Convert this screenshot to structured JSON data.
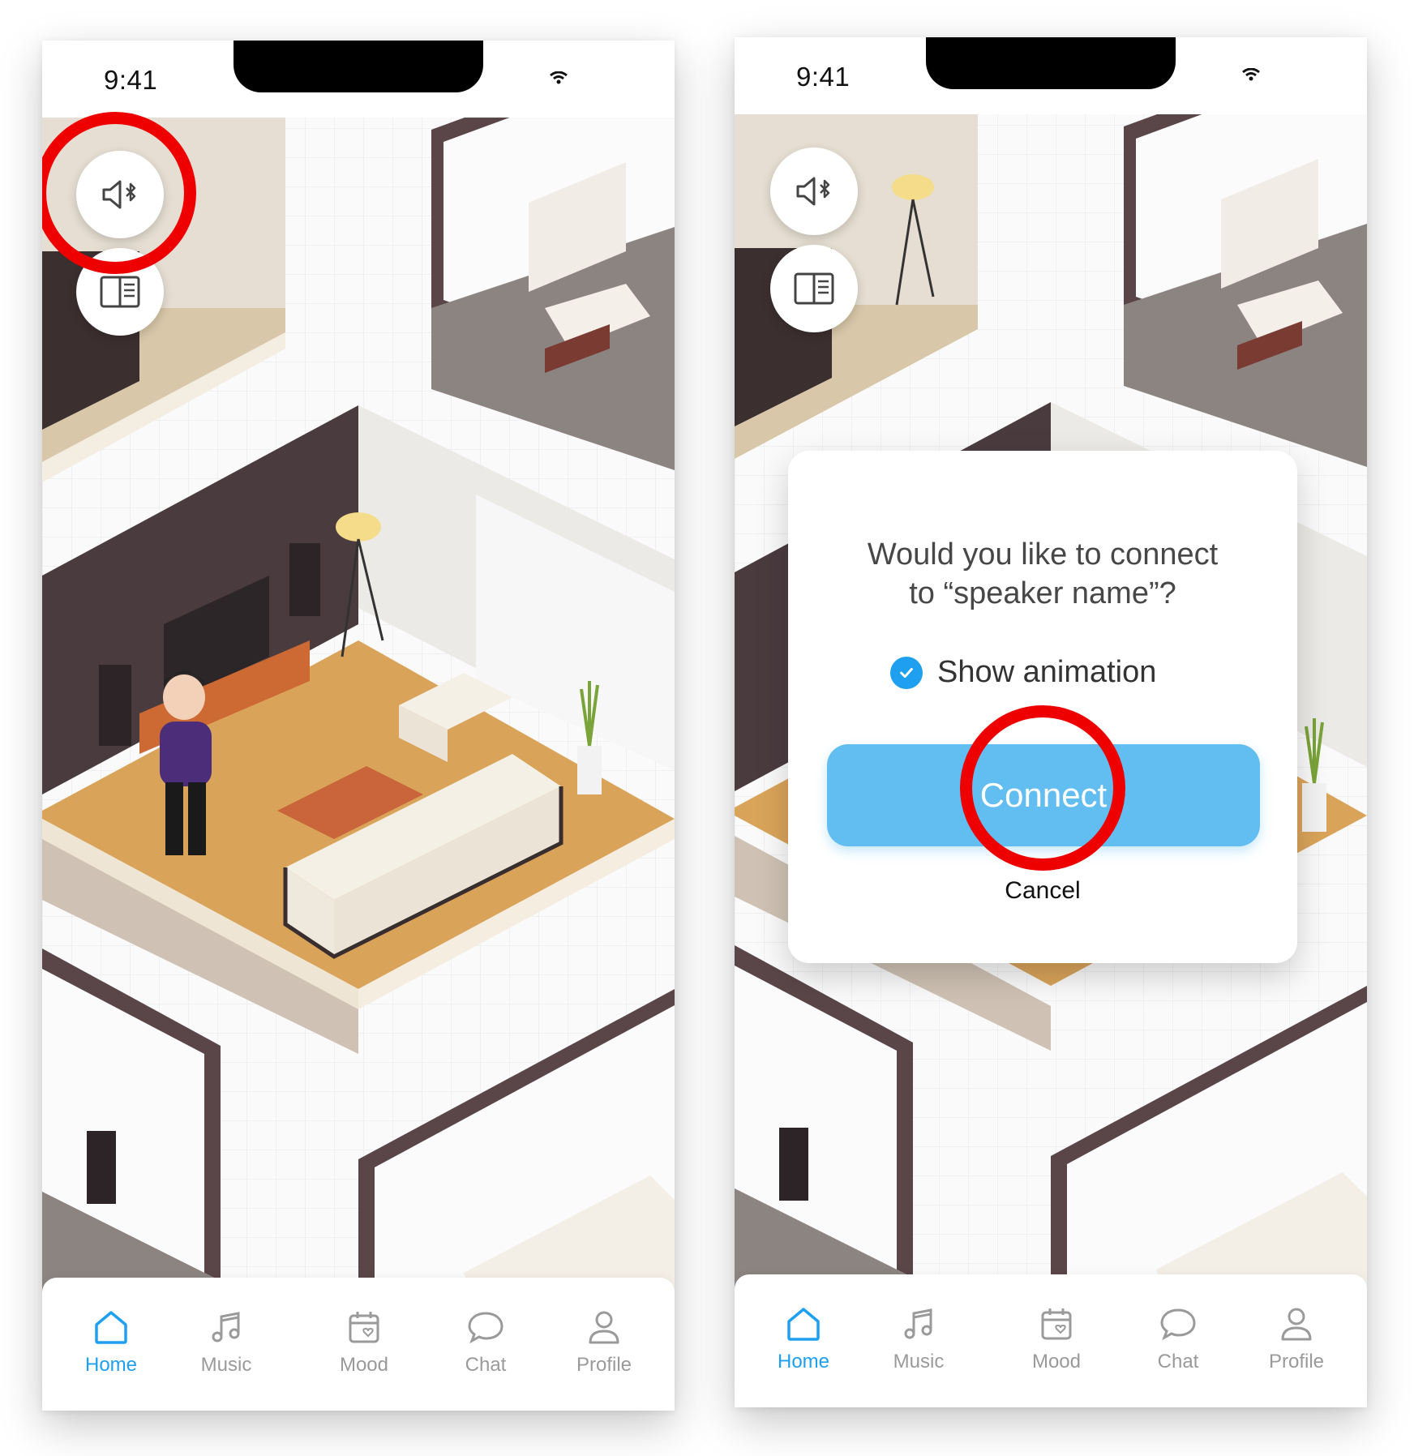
{
  "status_bar": {
    "time": "9:41"
  },
  "floating_buttons": [
    {
      "name": "bluetooth-speaker-button",
      "icon": "speaker-bluetooth-icon"
    },
    {
      "name": "book-button",
      "icon": "open-book-icon"
    }
  ],
  "tabs": [
    {
      "label": "Home",
      "icon": "home-icon",
      "active": true
    },
    {
      "label": "Music",
      "icon": "music-note-icon",
      "active": false
    },
    {
      "label": "Mood",
      "icon": "calendar-heart-icon",
      "active": false
    },
    {
      "label": "Chat",
      "icon": "chat-bubble-icon",
      "active": false
    },
    {
      "label": "Profile",
      "icon": "person-icon",
      "active": false
    }
  ],
  "dialog": {
    "question_line1": "Would you like to connect",
    "question_line2": "to “speaker name”?",
    "checkbox_label": "Show animation",
    "checkbox_checked": true,
    "connect_label": "Connect",
    "cancel_label": "Cancel"
  },
  "colors": {
    "accent": "#1e9ff0",
    "button_fill": "#62bdf1",
    "highlight_ring": "#ee0000",
    "inactive_tab": "#9a9a9a"
  }
}
